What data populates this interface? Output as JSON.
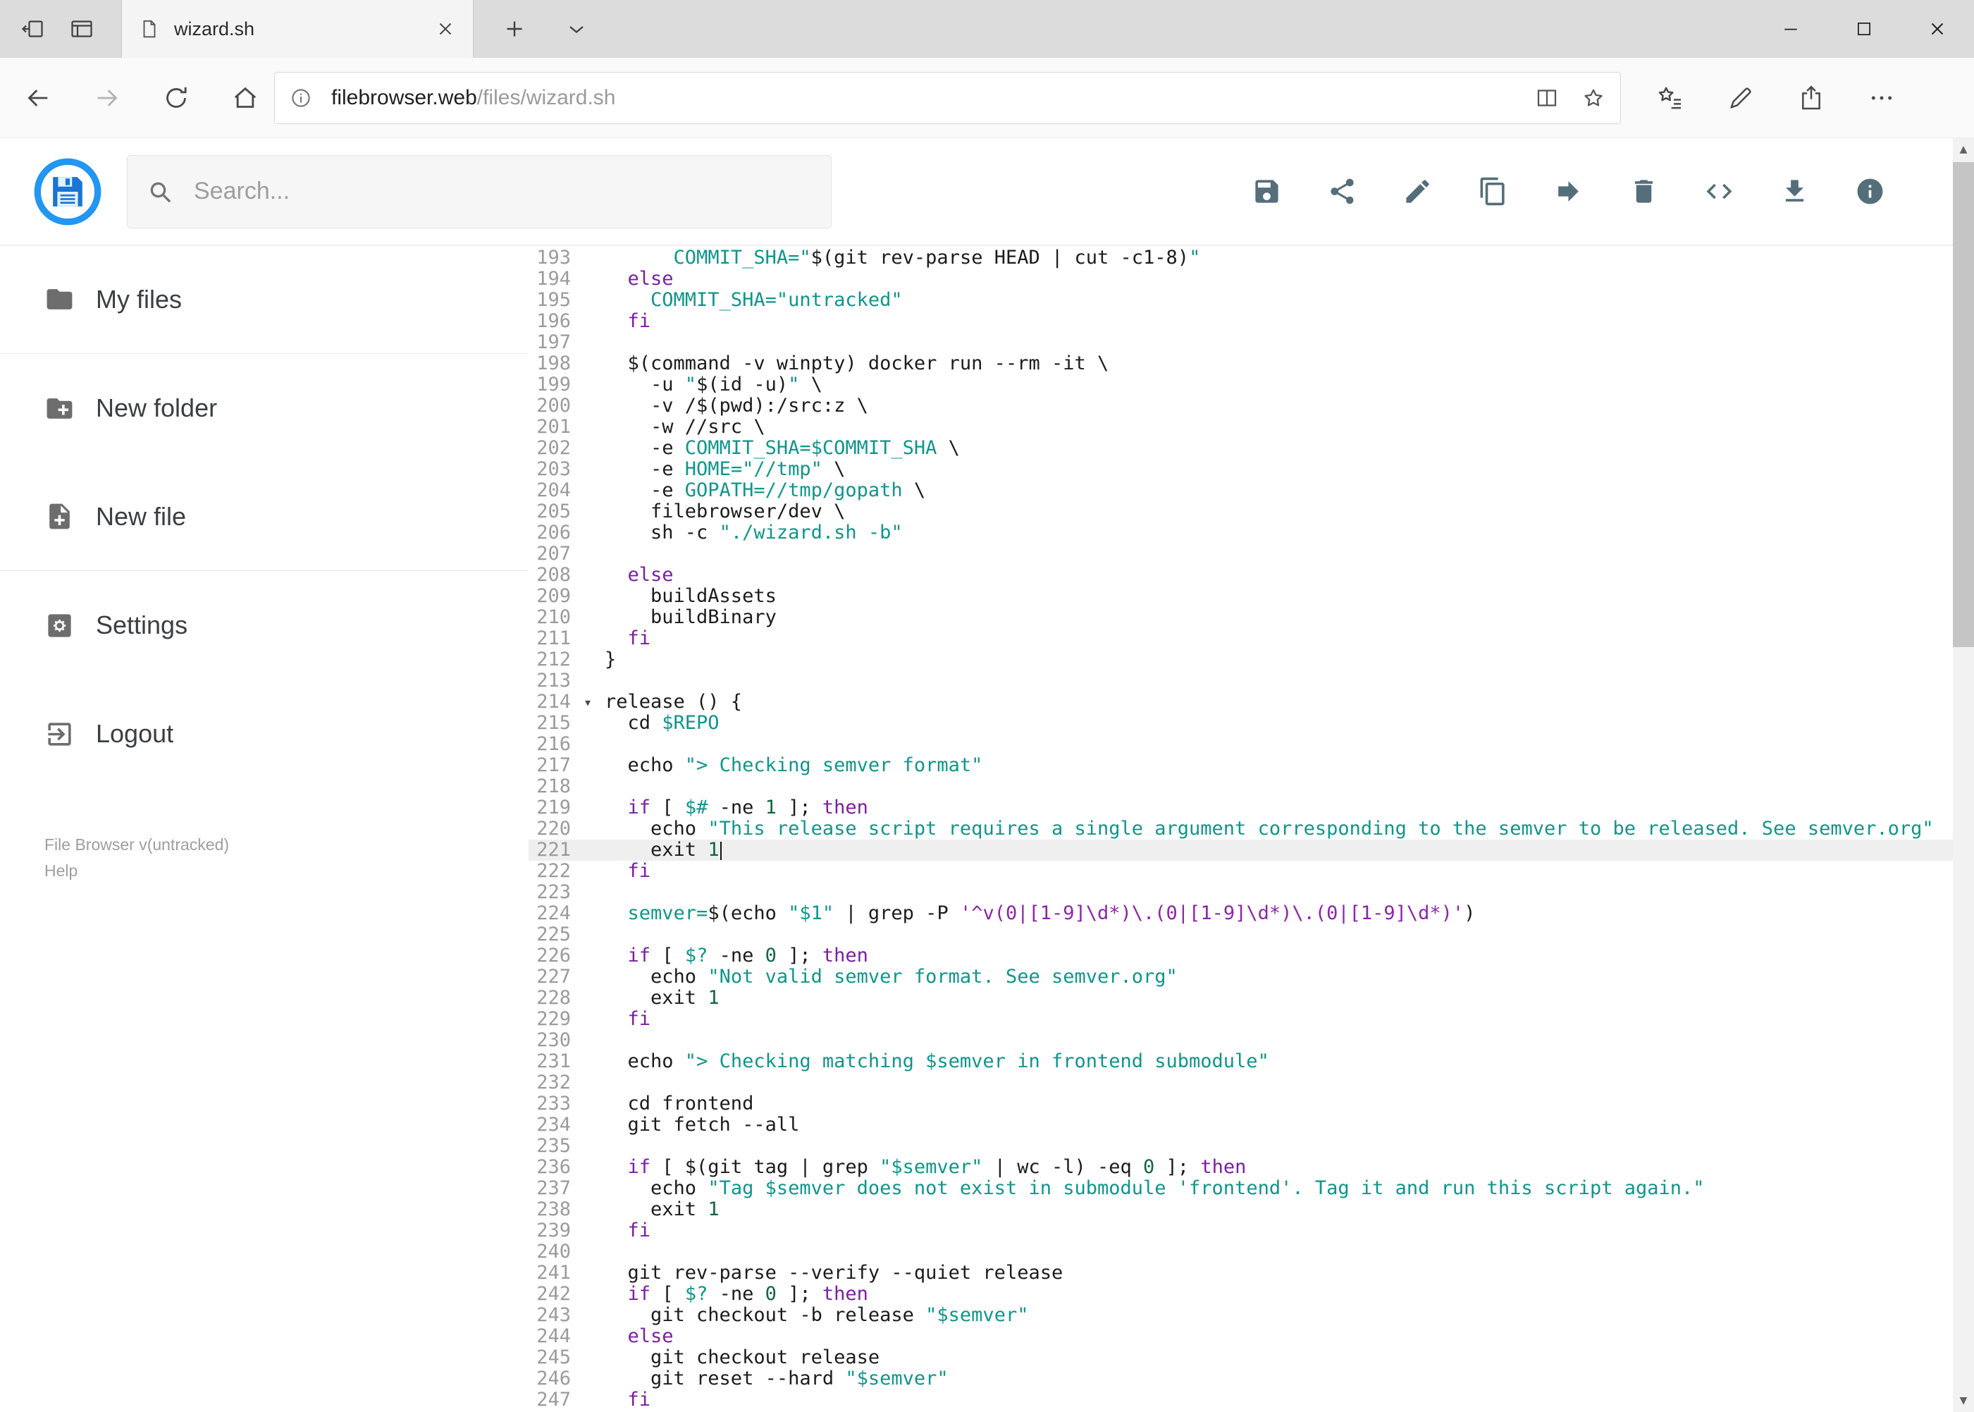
{
  "browser": {
    "tab_title": "wizard.sh",
    "url_host": "filebrowser.web",
    "url_path": "/files/wizard.sh"
  },
  "header": {
    "search_placeholder": "Search...",
    "toolbar": [
      {
        "name": "save",
        "icon": "save-icon"
      },
      {
        "name": "share",
        "icon": "share-icon"
      },
      {
        "name": "edit",
        "icon": "edit-icon"
      },
      {
        "name": "copy",
        "icon": "copy-icon"
      },
      {
        "name": "move",
        "icon": "move-icon"
      },
      {
        "name": "delete",
        "icon": "delete-icon"
      },
      {
        "name": "code",
        "icon": "code-icon"
      },
      {
        "name": "download",
        "icon": "download-icon"
      },
      {
        "name": "info",
        "icon": "info-icon"
      }
    ]
  },
  "sidebar": {
    "items": [
      {
        "label": "My files",
        "icon": "folder-icon"
      },
      {
        "label": "New folder",
        "icon": "new-folder-icon"
      },
      {
        "label": "New file",
        "icon": "new-file-icon"
      },
      {
        "label": "Settings",
        "icon": "settings-icon"
      },
      {
        "label": "Logout",
        "icon": "logout-icon"
      }
    ],
    "divider_after": [
      0,
      2
    ],
    "footer_version": "File Browser v(untracked)",
    "footer_help": "Help"
  },
  "colors": {
    "accent": "#2196f3",
    "toolbar_icon": "#546e7a",
    "keyword": "#7b1fa2",
    "string": "#0f968b",
    "number": "#116644",
    "regex": "#8e24aa",
    "active_line_bg": "#efefef"
  },
  "editor": {
    "active_line": 221,
    "fold_line": 214,
    "lines": [
      {
        "n": 193,
        "s": [
          [
            "p",
            "      "
          ],
          [
            "s",
            "COMMIT_SHA=\""
          ],
          [
            "p",
            "$(git rev-parse HEAD | cut -c1-8)"
          ],
          [
            "s",
            "\""
          ]
        ]
      },
      {
        "n": 194,
        "s": [
          [
            "p",
            "  "
          ],
          [
            "k",
            "else"
          ]
        ]
      },
      {
        "n": 195,
        "s": [
          [
            "p",
            "    "
          ],
          [
            "s",
            "COMMIT_SHA=\"untracked\""
          ]
        ]
      },
      {
        "n": 196,
        "s": [
          [
            "p",
            "  "
          ],
          [
            "k",
            "fi"
          ]
        ]
      },
      {
        "n": 197,
        "s": []
      },
      {
        "n": 198,
        "s": [
          [
            "p",
            "  $(command -v winpty) docker run --rm -it \\"
          ]
        ]
      },
      {
        "n": 199,
        "s": [
          [
            "p",
            "    -u "
          ],
          [
            "s",
            "\""
          ],
          [
            "p",
            "$(id -u)"
          ],
          [
            "s",
            "\""
          ],
          [
            "p",
            " \\"
          ]
        ]
      },
      {
        "n": 200,
        "s": [
          [
            "p",
            "    -v /$(pwd):/src:z \\"
          ]
        ]
      },
      {
        "n": 201,
        "s": [
          [
            "p",
            "    -w //src \\"
          ]
        ]
      },
      {
        "n": 202,
        "s": [
          [
            "p",
            "    -e "
          ],
          [
            "s",
            "COMMIT_SHA=$COMMIT_SHA"
          ],
          [
            "p",
            " \\"
          ]
        ]
      },
      {
        "n": 203,
        "s": [
          [
            "p",
            "    -e "
          ],
          [
            "s",
            "HOME=\"//tmp\""
          ],
          [
            "p",
            " \\"
          ]
        ]
      },
      {
        "n": 204,
        "s": [
          [
            "p",
            "    -e "
          ],
          [
            "s",
            "GOPATH=//tmp/gopath"
          ],
          [
            "p",
            " \\"
          ]
        ]
      },
      {
        "n": 205,
        "s": [
          [
            "p",
            "    filebrowser/dev \\"
          ]
        ]
      },
      {
        "n": 206,
        "s": [
          [
            "p",
            "    sh -c "
          ],
          [
            "s",
            "\"./wizard.sh -b\""
          ]
        ]
      },
      {
        "n": 207,
        "s": []
      },
      {
        "n": 208,
        "s": [
          [
            "p",
            "  "
          ],
          [
            "k",
            "else"
          ]
        ]
      },
      {
        "n": 209,
        "s": [
          [
            "p",
            "    buildAssets"
          ]
        ]
      },
      {
        "n": 210,
        "s": [
          [
            "p",
            "    buildBinary"
          ]
        ]
      },
      {
        "n": 211,
        "s": [
          [
            "p",
            "  "
          ],
          [
            "k",
            "fi"
          ]
        ]
      },
      {
        "n": 212,
        "s": [
          [
            "p",
            "}"
          ]
        ]
      },
      {
        "n": 213,
        "s": []
      },
      {
        "n": 214,
        "s": [
          [
            "p",
            "release () {"
          ]
        ]
      },
      {
        "n": 215,
        "s": [
          [
            "p",
            "  cd "
          ],
          [
            "s",
            "$REPO"
          ]
        ]
      },
      {
        "n": 216,
        "s": []
      },
      {
        "n": 217,
        "s": [
          [
            "p",
            "  echo "
          ],
          [
            "s",
            "\"> Checking semver format\""
          ]
        ]
      },
      {
        "n": 218,
        "s": []
      },
      {
        "n": 219,
        "s": [
          [
            "p",
            "  "
          ],
          [
            "k",
            "if"
          ],
          [
            "p",
            " [ "
          ],
          [
            "s",
            "$#"
          ],
          [
            "p",
            " -ne "
          ],
          [
            "n",
            "1"
          ],
          [
            "p",
            " ]; "
          ],
          [
            "k",
            "then"
          ]
        ]
      },
      {
        "n": 220,
        "s": [
          [
            "p",
            "    echo "
          ],
          [
            "s",
            "\"This release script requires a single argument corresponding to the semver to be released. See semver.org\""
          ]
        ]
      },
      {
        "n": 221,
        "s": [
          [
            "p",
            "    exit "
          ],
          [
            "n",
            "1"
          ],
          [
            "x",
            ""
          ]
        ]
      },
      {
        "n": 222,
        "s": [
          [
            "p",
            "  "
          ],
          [
            "k",
            "fi"
          ]
        ]
      },
      {
        "n": 223,
        "s": []
      },
      {
        "n": 224,
        "s": [
          [
            "p",
            "  "
          ],
          [
            "s",
            "semver="
          ],
          [
            "p",
            "$(echo "
          ],
          [
            "s",
            "\"$1\""
          ],
          [
            "p",
            " | grep -P "
          ],
          [
            "r",
            "'^v(0|[1-9]\\d*)\\.(0|[1-9]\\d*)\\.(0|[1-9]\\d*)'"
          ],
          [
            "p",
            ")"
          ]
        ]
      },
      {
        "n": 225,
        "s": []
      },
      {
        "n": 226,
        "s": [
          [
            "p",
            "  "
          ],
          [
            "k",
            "if"
          ],
          [
            "p",
            " [ "
          ],
          [
            "s",
            "$?"
          ],
          [
            "p",
            " -ne "
          ],
          [
            "n",
            "0"
          ],
          [
            "p",
            " ]; "
          ],
          [
            "k",
            "then"
          ]
        ]
      },
      {
        "n": 227,
        "s": [
          [
            "p",
            "    echo "
          ],
          [
            "s",
            "\"Not valid semver format. See semver.org\""
          ]
        ]
      },
      {
        "n": 228,
        "s": [
          [
            "p",
            "    exit "
          ],
          [
            "n",
            "1"
          ]
        ]
      },
      {
        "n": 229,
        "s": [
          [
            "p",
            "  "
          ],
          [
            "k",
            "fi"
          ]
        ]
      },
      {
        "n": 230,
        "s": []
      },
      {
        "n": 231,
        "s": [
          [
            "p",
            "  echo "
          ],
          [
            "s",
            "\"> Checking matching $semver in frontend submodule\""
          ]
        ]
      },
      {
        "n": 232,
        "s": []
      },
      {
        "n": 233,
        "s": [
          [
            "p",
            "  cd frontend"
          ]
        ]
      },
      {
        "n": 234,
        "s": [
          [
            "p",
            "  git fetch --all"
          ]
        ]
      },
      {
        "n": 235,
        "s": []
      },
      {
        "n": 236,
        "s": [
          [
            "p",
            "  "
          ],
          [
            "k",
            "if"
          ],
          [
            "p",
            " [ $(git tag | grep "
          ],
          [
            "s",
            "\"$semver\""
          ],
          [
            "p",
            " | wc -l) -eq "
          ],
          [
            "n",
            "0"
          ],
          [
            "p",
            " ]; "
          ],
          [
            "k",
            "then"
          ]
        ]
      },
      {
        "n": 237,
        "s": [
          [
            "p",
            "    echo "
          ],
          [
            "s",
            "\"Tag $semver does not exist in submodule 'frontend'. Tag it and run this script again.\""
          ]
        ]
      },
      {
        "n": 238,
        "s": [
          [
            "p",
            "    exit "
          ],
          [
            "n",
            "1"
          ]
        ]
      },
      {
        "n": 239,
        "s": [
          [
            "p",
            "  "
          ],
          [
            "k",
            "fi"
          ]
        ]
      },
      {
        "n": 240,
        "s": []
      },
      {
        "n": 241,
        "s": [
          [
            "p",
            "  git rev-parse --verify --quiet release"
          ]
        ]
      },
      {
        "n": 242,
        "s": [
          [
            "p",
            "  "
          ],
          [
            "k",
            "if"
          ],
          [
            "p",
            " [ "
          ],
          [
            "s",
            "$?"
          ],
          [
            "p",
            " -ne "
          ],
          [
            "n",
            "0"
          ],
          [
            "p",
            " ]; "
          ],
          [
            "k",
            "then"
          ]
        ]
      },
      {
        "n": 243,
        "s": [
          [
            "p",
            "    git checkout -b release "
          ],
          [
            "s",
            "\"$semver\""
          ]
        ]
      },
      {
        "n": 244,
        "s": [
          [
            "p",
            "  "
          ],
          [
            "k",
            "else"
          ]
        ]
      },
      {
        "n": 245,
        "s": [
          [
            "p",
            "    git checkout release"
          ]
        ]
      },
      {
        "n": 246,
        "s": [
          [
            "p",
            "    git reset --hard "
          ],
          [
            "s",
            "\"$semver\""
          ]
        ]
      },
      {
        "n": 247,
        "s": [
          [
            "p",
            "  "
          ],
          [
            "k",
            "fi"
          ]
        ]
      }
    ]
  }
}
